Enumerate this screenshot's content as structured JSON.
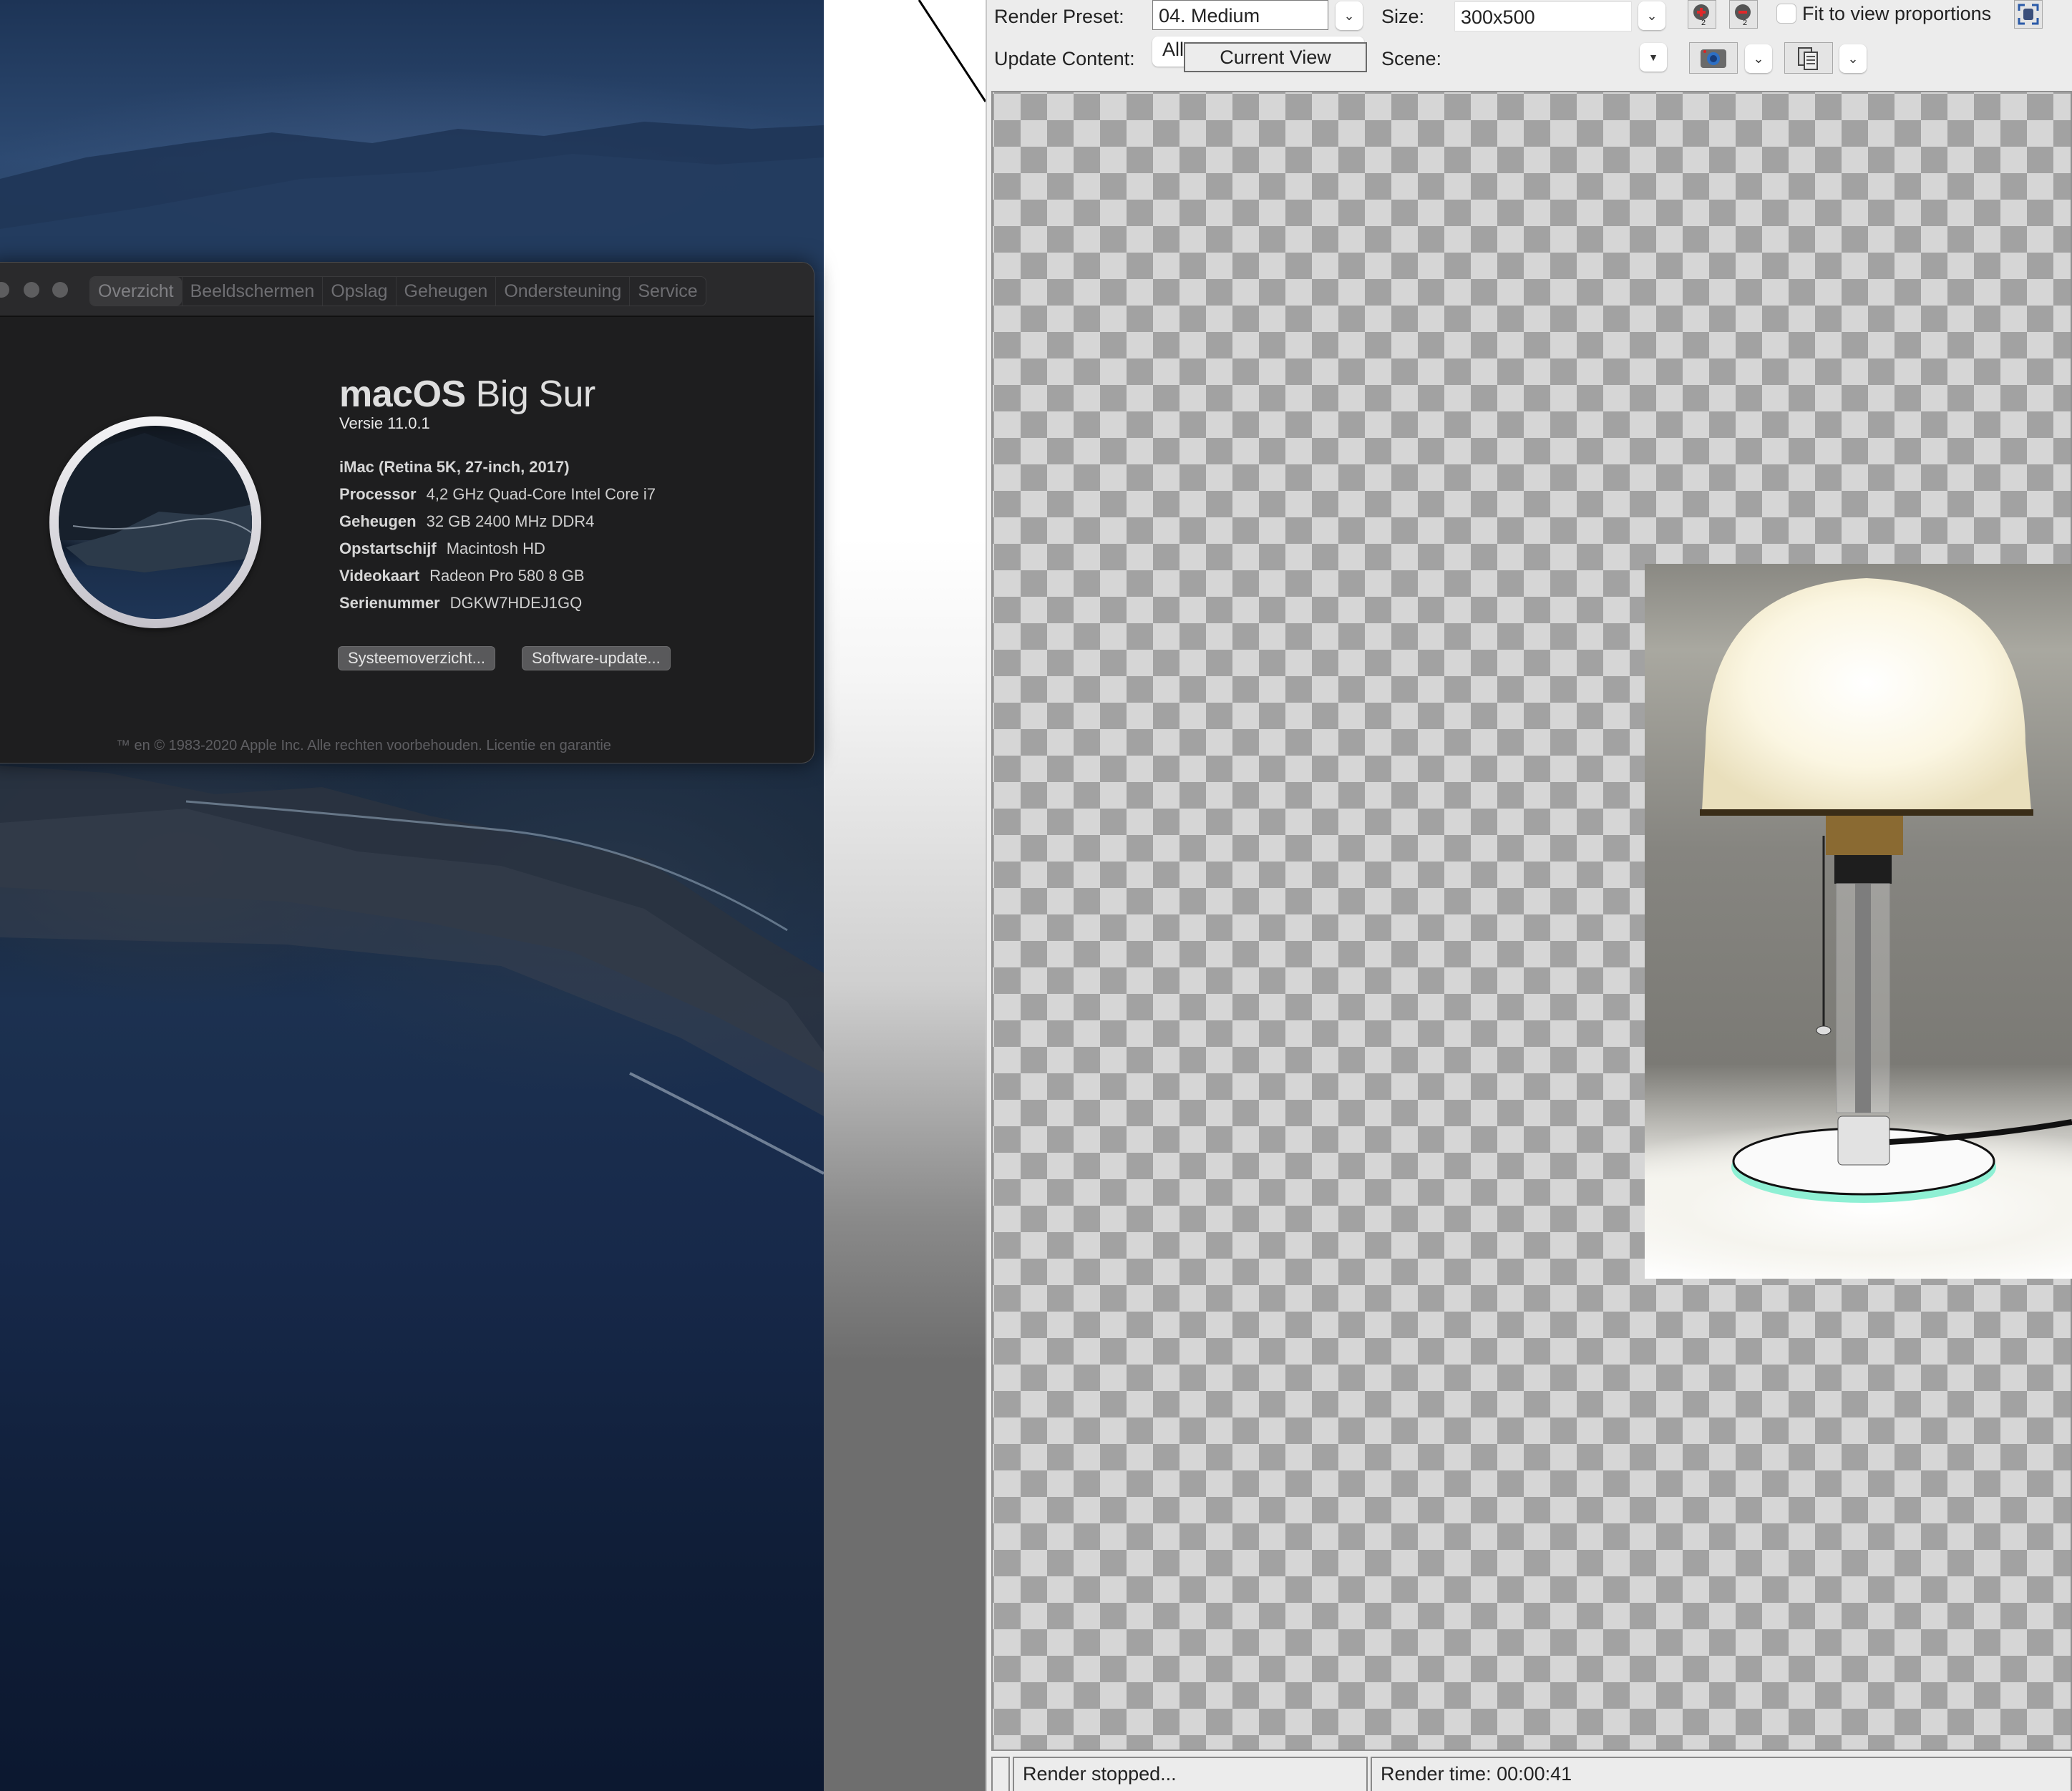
{
  "about_window": {
    "tabs": [
      {
        "label": "Overzicht",
        "active": true
      },
      {
        "label": "Beeldschermen",
        "active": false
      },
      {
        "label": "Opslag",
        "active": false
      },
      {
        "label": "Geheugen",
        "active": false
      },
      {
        "label": "Ondersteuning",
        "active": false
      },
      {
        "label": "Service",
        "active": false
      }
    ],
    "os_name_bold": "macOS",
    "os_name_light": "Big Sur",
    "version": "Versie 11.0.1",
    "model": "iMac (Retina 5K, 27-inch, 2017)",
    "specs": [
      {
        "key": "Processor",
        "value": "4,2 GHz Quad-Core Intel Core i7"
      },
      {
        "key": "Geheugen",
        "value": "32 GB 2400 MHz DDR4"
      },
      {
        "key": "Opstartschijf",
        "value": "Macintosh HD"
      },
      {
        "key": "Videokaart",
        "value": "Radeon Pro 580 8 GB"
      },
      {
        "key": "Serienummer",
        "value": "DGKW7HDEJ1GQ"
      }
    ],
    "buttons": {
      "system_report": "Systeemoverzicht...",
      "software_update": "Software-update..."
    },
    "copyright": "™ en © 1983-2020 Apple Inc. Alle rechten voorbehouden. Licentie en garantie",
    "icon": "macos-big-sur-icon"
  },
  "render_window": {
    "render_preset_label": "Render Preset:",
    "render_preset_value": "04. Medium",
    "size_label": "Size:",
    "size_value": "300x500",
    "fit_to_view_label": "Fit to view proportions",
    "fit_to_view_checked": false,
    "update_content_label": "Update Content:",
    "update_content_value": "All",
    "scene_label": "Scene:",
    "scene_value": "Current View",
    "icons": {
      "zoom_in": "zoom-in-2x-icon",
      "zoom_out": "zoom-out-2x-icon",
      "fit": "fit-to-window-icon",
      "snapshot": "camera-icon",
      "copy": "copy-documents-icon"
    },
    "status_text": "Render stopped...",
    "render_time": "Render time: 00:00:41",
    "render_subject": "table lamp render"
  }
}
